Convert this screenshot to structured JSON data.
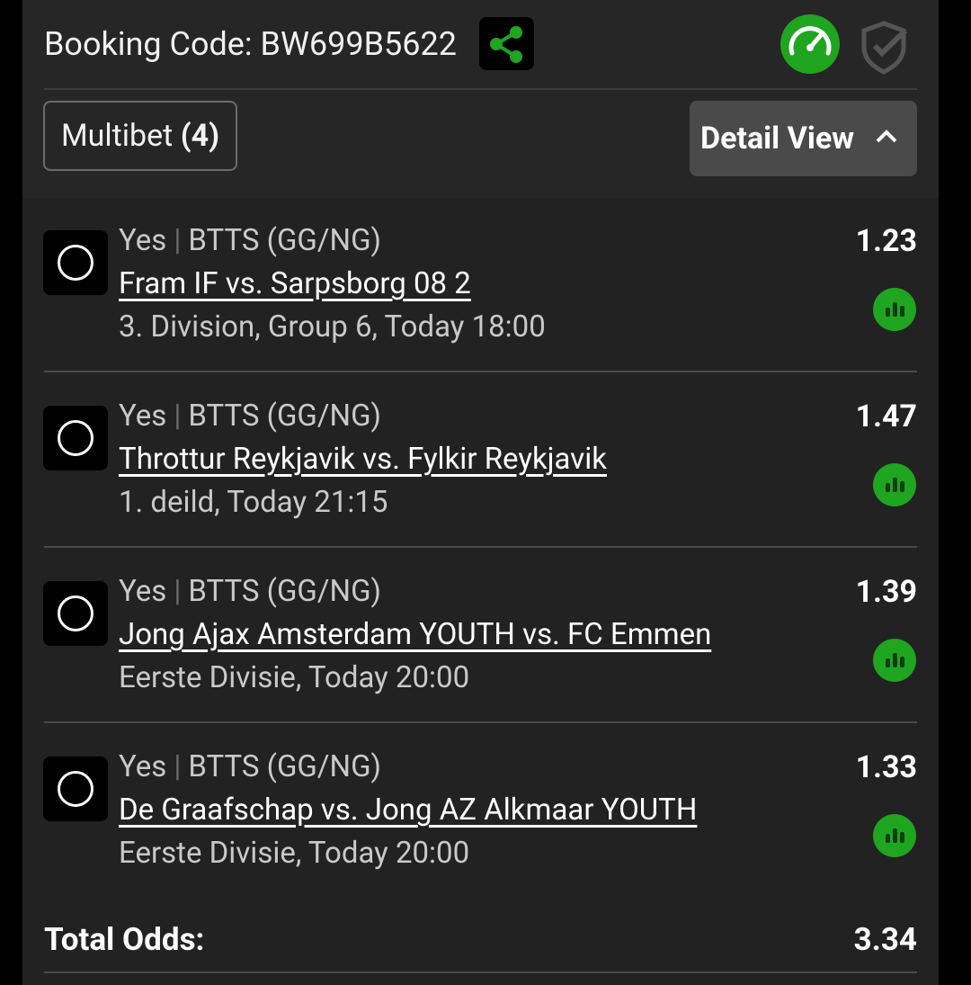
{
  "header": {
    "booking_label": "Booking Code:",
    "booking_code": "BW699B5622",
    "share_icon": "share-icon",
    "speed_icon": "speedometer-icon",
    "shield_icon": "shield-check-icon",
    "multibet_label": "Multibet",
    "multibet_count": "(4)",
    "detail_view_label": "Detail View"
  },
  "selections": [
    {
      "pick": "Yes",
      "market": "BTTS (GG/NG)",
      "match": "Fram IF vs. Sarpsborg 08 2",
      "league": "3. Division, Group 6, Today 18:00",
      "odds": "1.23"
    },
    {
      "pick": "Yes",
      "market": "BTTS (GG/NG)",
      "match": "Throttur Reykjavik vs. Fylkir Reykjavik",
      "league": "1. deild, Today 21:15",
      "odds": "1.47"
    },
    {
      "pick": "Yes",
      "market": "BTTS (GG/NG)",
      "match": "Jong Ajax Amsterdam YOUTH vs. FC Emmen",
      "league": "Eerste Divisie, Today 20:00",
      "odds": "1.39"
    },
    {
      "pick": "Yes",
      "market": "BTTS (GG/NG)",
      "match": "De Graafschap vs. Jong AZ Alkmaar YOUTH",
      "league": "Eerste Divisie, Today 20:00",
      "odds": "1.33"
    }
  ],
  "total": {
    "label": "Total Odds:",
    "value": "3.34"
  },
  "colors": {
    "accent_green": "#1fa51f",
    "background": "#222222"
  }
}
